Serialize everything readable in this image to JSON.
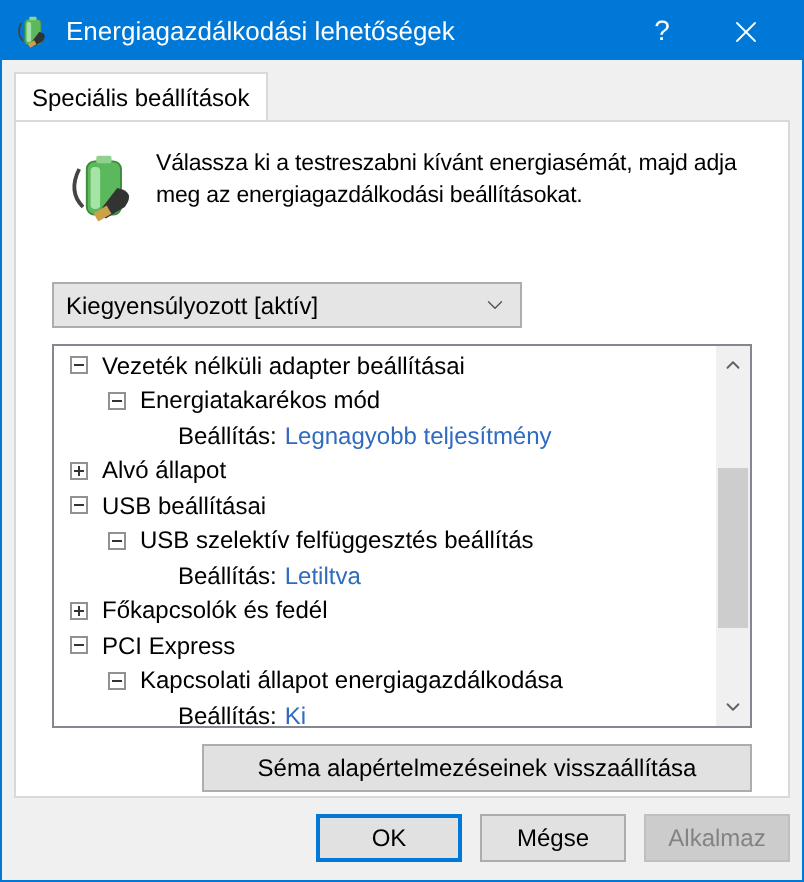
{
  "window": {
    "title": "Energiagazdálkodási lehetőségek",
    "help": "?"
  },
  "tabs": [
    {
      "label": "Speciális beállítások",
      "selected": true
    }
  ],
  "description": "Válassza ki a testreszabni kívánt energiasémát, majd adja meg az energiagazdálkodási beállításokat.",
  "plan_select": {
    "value": "Kiegyensúlyozott [aktív]"
  },
  "tree": [
    {
      "kind": "group",
      "label": "Vezeték nélküli adapter beállításai",
      "expanded": true,
      "children": [
        {
          "kind": "group",
          "label": "Energiatakarékos mód",
          "expanded": true,
          "children": [
            {
              "kind": "setting",
              "label": "Beállítás:",
              "value": "Legnagyobb teljesítmény"
            }
          ]
        }
      ]
    },
    {
      "kind": "group",
      "label": "Alvó állapot",
      "expanded": false
    },
    {
      "kind": "group",
      "label": "USB beállításai",
      "expanded": true,
      "children": [
        {
          "kind": "group",
          "label": "USB szelektív felfüggesztés beállítás",
          "expanded": true,
          "children": [
            {
              "kind": "setting",
              "label": "Beállítás:",
              "value": "Letiltva"
            }
          ]
        }
      ]
    },
    {
      "kind": "group",
      "label": "Főkapcsolók és fedél",
      "expanded": false
    },
    {
      "kind": "group",
      "label": "PCI Express",
      "expanded": true,
      "children": [
        {
          "kind": "group",
          "label": "Kapcsolati állapot energiagazdálkodása",
          "expanded": true,
          "children": [
            {
              "kind": "setting",
              "label": "Beállítás:",
              "value": "Ki"
            }
          ]
        }
      ]
    }
  ],
  "restore_button": "Séma alapértelmezéseinek visszaállítása",
  "buttons": [
    {
      "label": "OK",
      "default": true,
      "disabled": false
    },
    {
      "label": "Mégse",
      "default": false,
      "disabled": false
    },
    {
      "label": "Alkalmaz",
      "default": false,
      "disabled": true
    }
  ]
}
